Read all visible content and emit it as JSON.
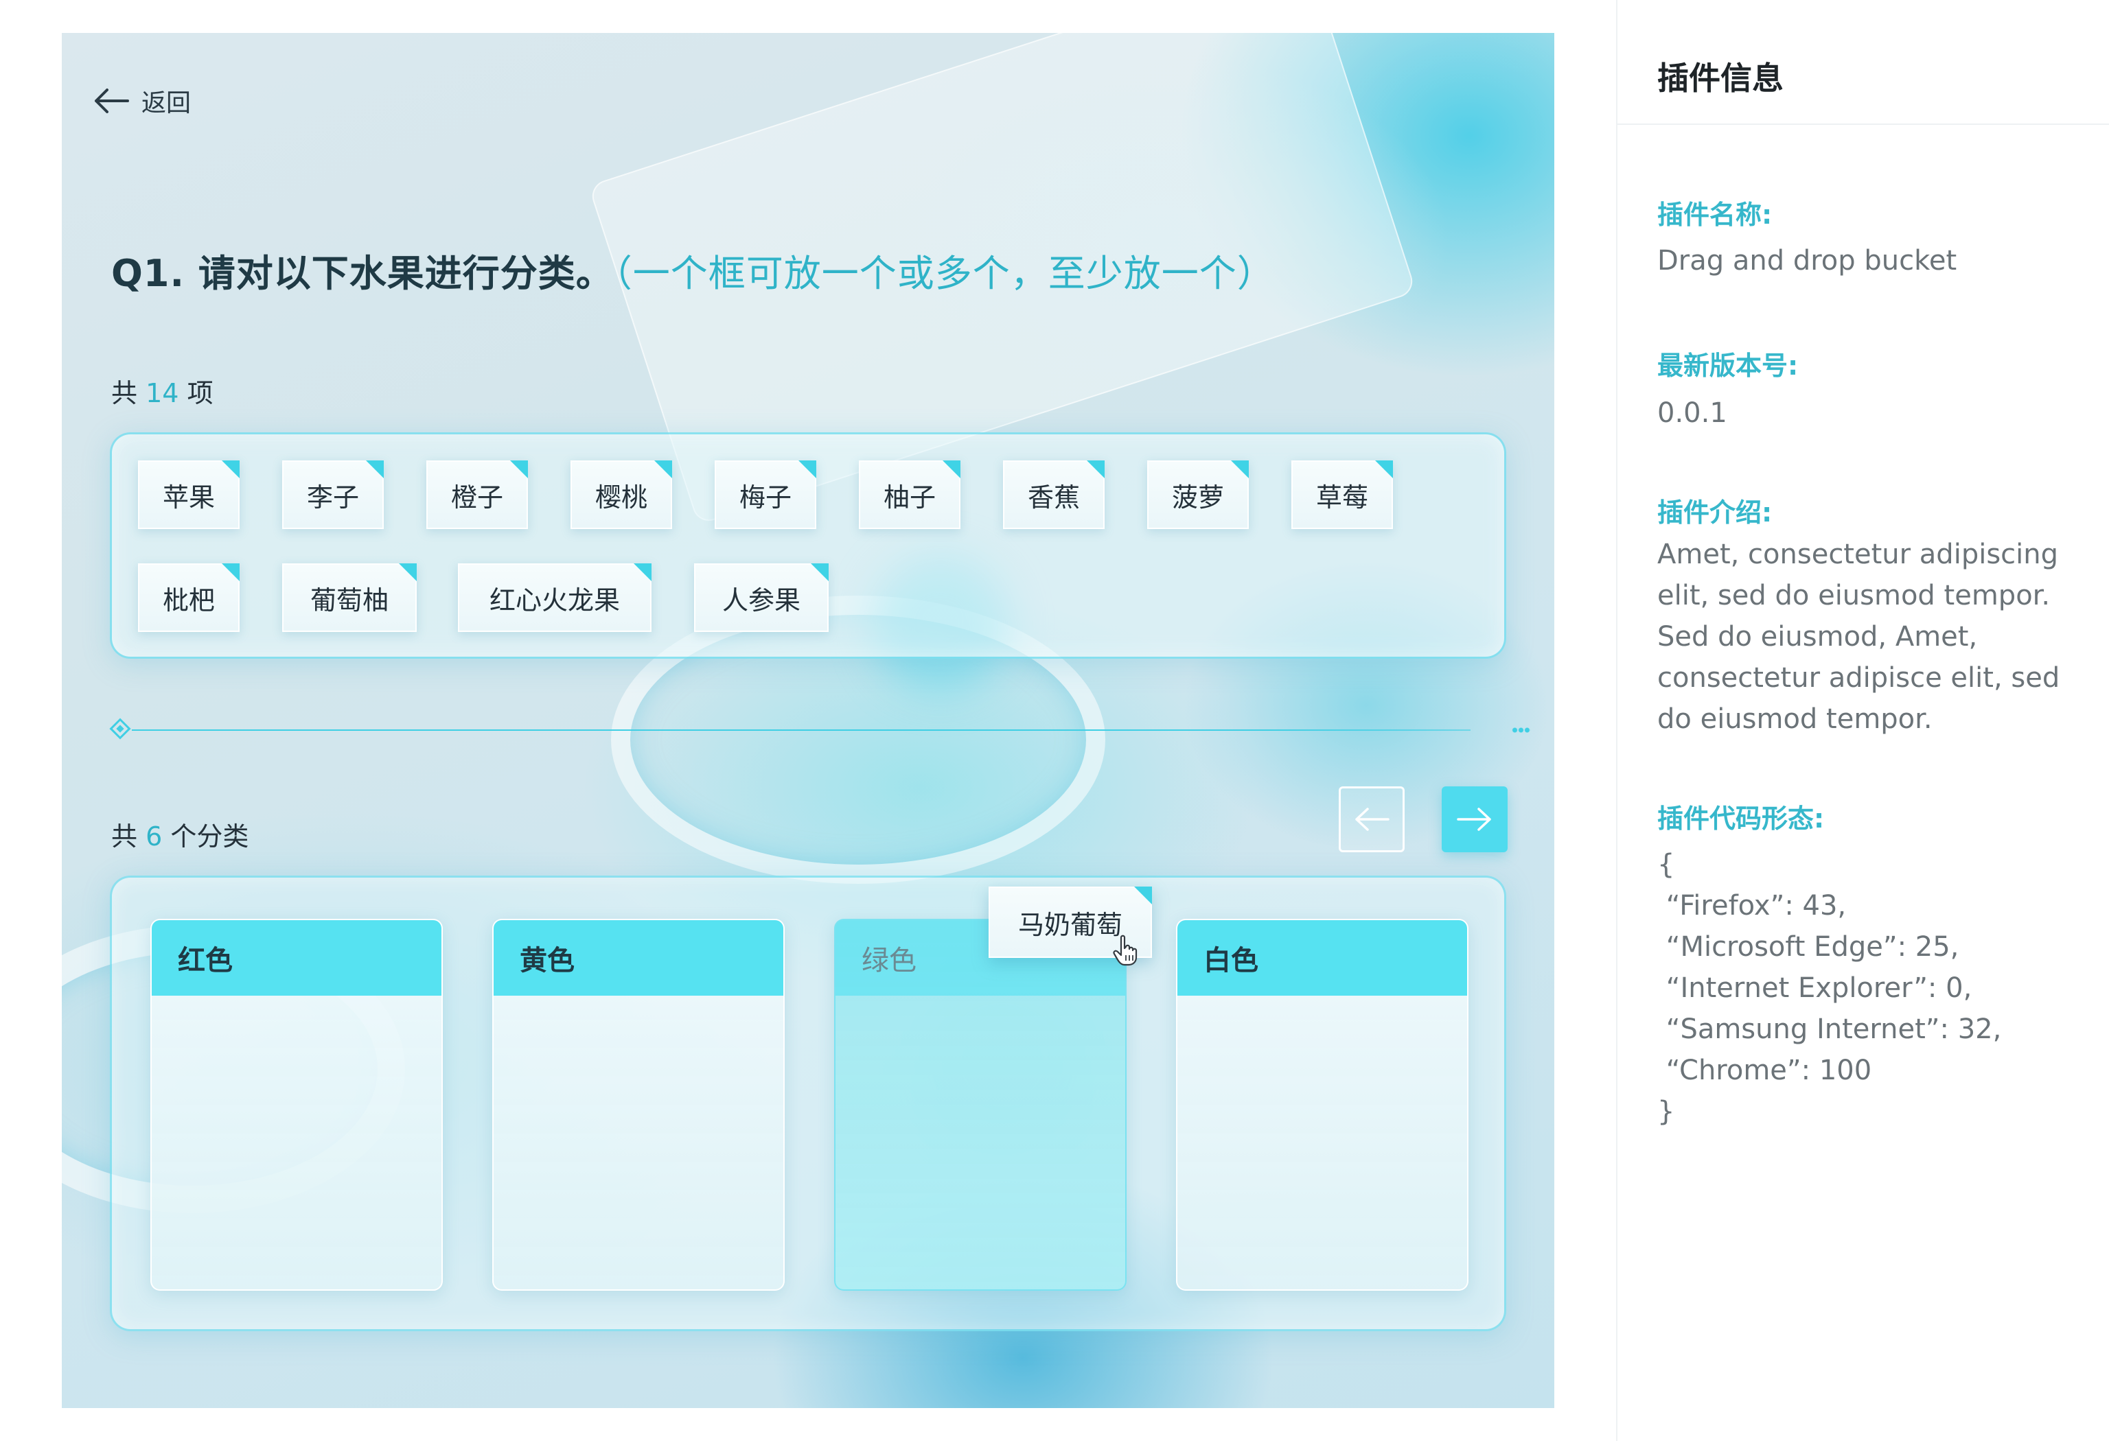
{
  "back": {
    "label": "返回"
  },
  "question": {
    "title": "Q1. 请对以下水果进行分类。",
    "hint": "（一个框可放一个或多个，至少放一个）"
  },
  "items_count": {
    "prefix": "共",
    "value": "14",
    "suffix": "项"
  },
  "items": [
    "苹果",
    "李子",
    "橙子",
    "樱桃",
    "梅子",
    "柚子",
    "香蕉",
    "菠萝",
    "草莓",
    "枇杷",
    "葡萄柚",
    "红心火龙果",
    "人参果"
  ],
  "categories_count": {
    "prefix": "共",
    "value": "6",
    "suffix": "个分类"
  },
  "categories": [
    {
      "name": "红色"
    },
    {
      "name": "黄色"
    },
    {
      "name": "绿色"
    },
    {
      "name": "白色"
    }
  ],
  "dragging_item": "马奶葡萄",
  "nav": {
    "prev": "arrow-left-icon",
    "next": "arrow-right-icon"
  },
  "sidebar": {
    "title": "插件信息",
    "name_label": "插件名称:",
    "name_value": "Drag and drop bucket",
    "version_label": "最新版本号:",
    "version_value": "0.0.1",
    "intro_label": "插件介绍:",
    "intro_value": "Amet, consectetur adipiscing elit, sed do eiusmod tempor. Sed do eiusmod, Amet, consectetur adipisce elit, sed do eiusmod tempor.",
    "code_label": "插件代码形态:",
    "code_value": "{\n “Firefox”: 43,\n “Microsoft Edge”: 25,\n “Internet Explorer”: 0,\n “Samsung Internet”: 32,\n “Chrome”: 100\n}"
  },
  "colors": {
    "accent": "#3fd3e6",
    "header": "#56e2f1",
    "label": "#36b7cb"
  }
}
